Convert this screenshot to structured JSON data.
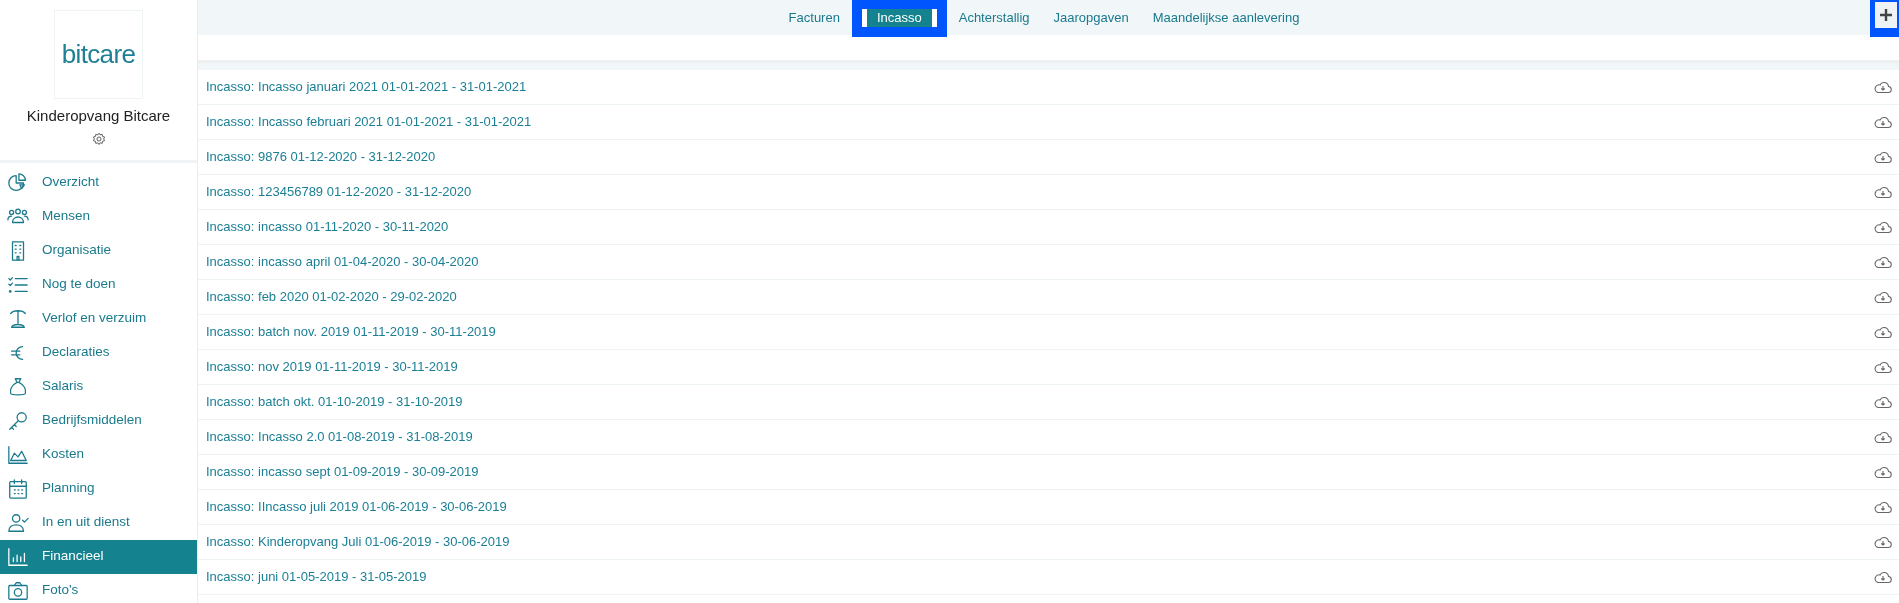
{
  "sidebar": {
    "logo": "bitcare",
    "organization": "Kinderopvang Bitcare",
    "items": [
      {
        "label": "Overzicht",
        "selected": false
      },
      {
        "label": "Mensen",
        "selected": false
      },
      {
        "label": "Organisatie",
        "selected": false
      },
      {
        "label": "Nog te doen",
        "selected": false
      },
      {
        "label": "Verlof en verzuim",
        "selected": false
      },
      {
        "label": "Declaraties",
        "selected": false
      },
      {
        "label": "Salaris",
        "selected": false
      },
      {
        "label": "Bedrijfsmiddelen",
        "selected": false
      },
      {
        "label": "Kosten",
        "selected": false
      },
      {
        "label": "Planning",
        "selected": false
      },
      {
        "label": "In en uit dienst",
        "selected": false
      },
      {
        "label": "Financieel",
        "selected": true
      },
      {
        "label": "Foto's",
        "selected": false
      }
    ]
  },
  "tabs": [
    {
      "label": "Facturen",
      "selected": false
    },
    {
      "label": "Incasso",
      "selected": true
    },
    {
      "label": "Achterstallig",
      "selected": false
    },
    {
      "label": "Jaaropgaven",
      "selected": false
    },
    {
      "label": "Maandelijkse aanlevering",
      "selected": false
    }
  ],
  "rows": [
    "Incasso: Incasso januari 2021 01-01-2021 - 31-01-2021",
    "Incasso: Incasso februari 2021 01-01-2021 - 31-01-2021",
    "Incasso: 9876 01-12-2020 - 31-12-2020",
    "Incasso: 123456789 01-12-2020 - 31-12-2020",
    "Incasso: incasso 01-11-2020 - 30-11-2020",
    "Incasso: incasso april 01-04-2020 - 30-04-2020",
    "Incasso: feb 2020 01-02-2020 - 29-02-2020",
    "Incasso: batch nov. 2019 01-11-2019 - 30-11-2019",
    "Incasso: nov 2019 01-11-2019 - 30-11-2019",
    "Incasso: batch okt. 01-10-2019 - 31-10-2019",
    "Incasso: Incasso 2.0 01-08-2019 - 31-08-2019",
    "Incasso: incasso sept 01-09-2019 - 30-09-2019",
    "Incasso: IIncasso juli 2019 01-06-2019 - 30-06-2019",
    "Incasso: Kinderopvang Juli 01-06-2019 - 30-06-2019",
    "Incasso: juni 01-05-2019 - 31-05-2019"
  ]
}
